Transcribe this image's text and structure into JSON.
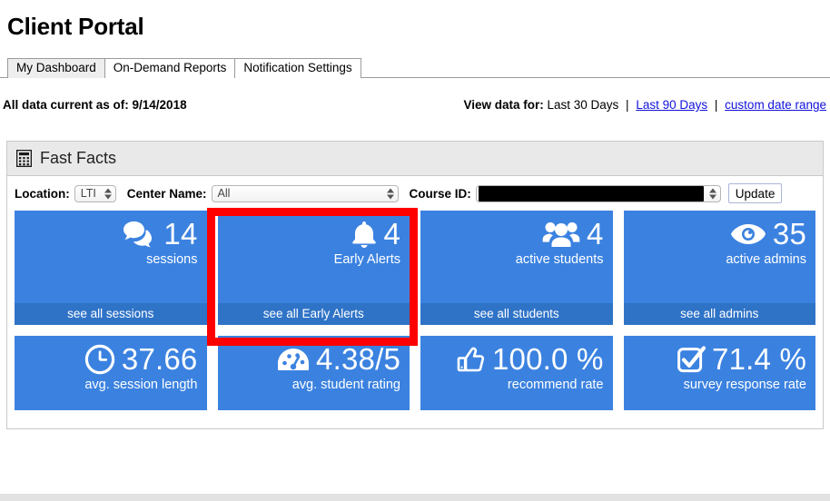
{
  "page_title": "Client Portal",
  "tabs": [
    {
      "label": "My Dashboard",
      "active": true
    },
    {
      "label": "On-Demand Reports",
      "active": false
    },
    {
      "label": "Notification Settings",
      "active": false
    }
  ],
  "data_status": {
    "current_as_of": "All data current as of: 9/14/2018",
    "view_data_label": "View data for:",
    "selected_range": "Last 30 Days",
    "separator": "|",
    "link_90_days": "Last 90 Days",
    "link_custom_range": "custom date range"
  },
  "panel": {
    "title": "Fast Facts",
    "icon": "calculator-icon"
  },
  "filters": {
    "location_label": "Location:",
    "location_value": "LTI",
    "center_label": "Center Name:",
    "center_value": "All",
    "course_id_label": "Course ID:",
    "course_id_value": "",
    "update_button": "Update"
  },
  "cards": {
    "row1": [
      {
        "icon": "speech-bubbles-icon",
        "value": "14",
        "label": "sessions",
        "footer": "see all sessions",
        "highlighted": false
      },
      {
        "icon": "bell-icon",
        "value": "4",
        "label": "Early Alerts",
        "footer": "see all Early Alerts",
        "highlighted": true
      },
      {
        "icon": "people-group-icon",
        "value": "4",
        "label": "active students",
        "footer": "see all students",
        "highlighted": false
      },
      {
        "icon": "eye-icon",
        "value": "35",
        "label": "active admins",
        "footer": "see all admins",
        "highlighted": false
      }
    ],
    "row2": [
      {
        "icon": "clock-icon",
        "value": "37.66",
        "label": "avg. session length"
      },
      {
        "icon": "gauge-icon",
        "value": "4.38/5",
        "label": "avg. student rating"
      },
      {
        "icon": "thumbs-up-icon",
        "value": "100.0 %",
        "label": "recommend rate"
      },
      {
        "icon": "checkbox-check-icon",
        "value": "71.4 %",
        "label": "survey response rate"
      }
    ]
  },
  "colors": {
    "card_blue": "#3b82e0",
    "card_footer_blue": "#2f73c7",
    "highlight_red": "#fe0000",
    "link_blue": "#1111dd",
    "panel_header_gray": "#e9e9e9"
  }
}
